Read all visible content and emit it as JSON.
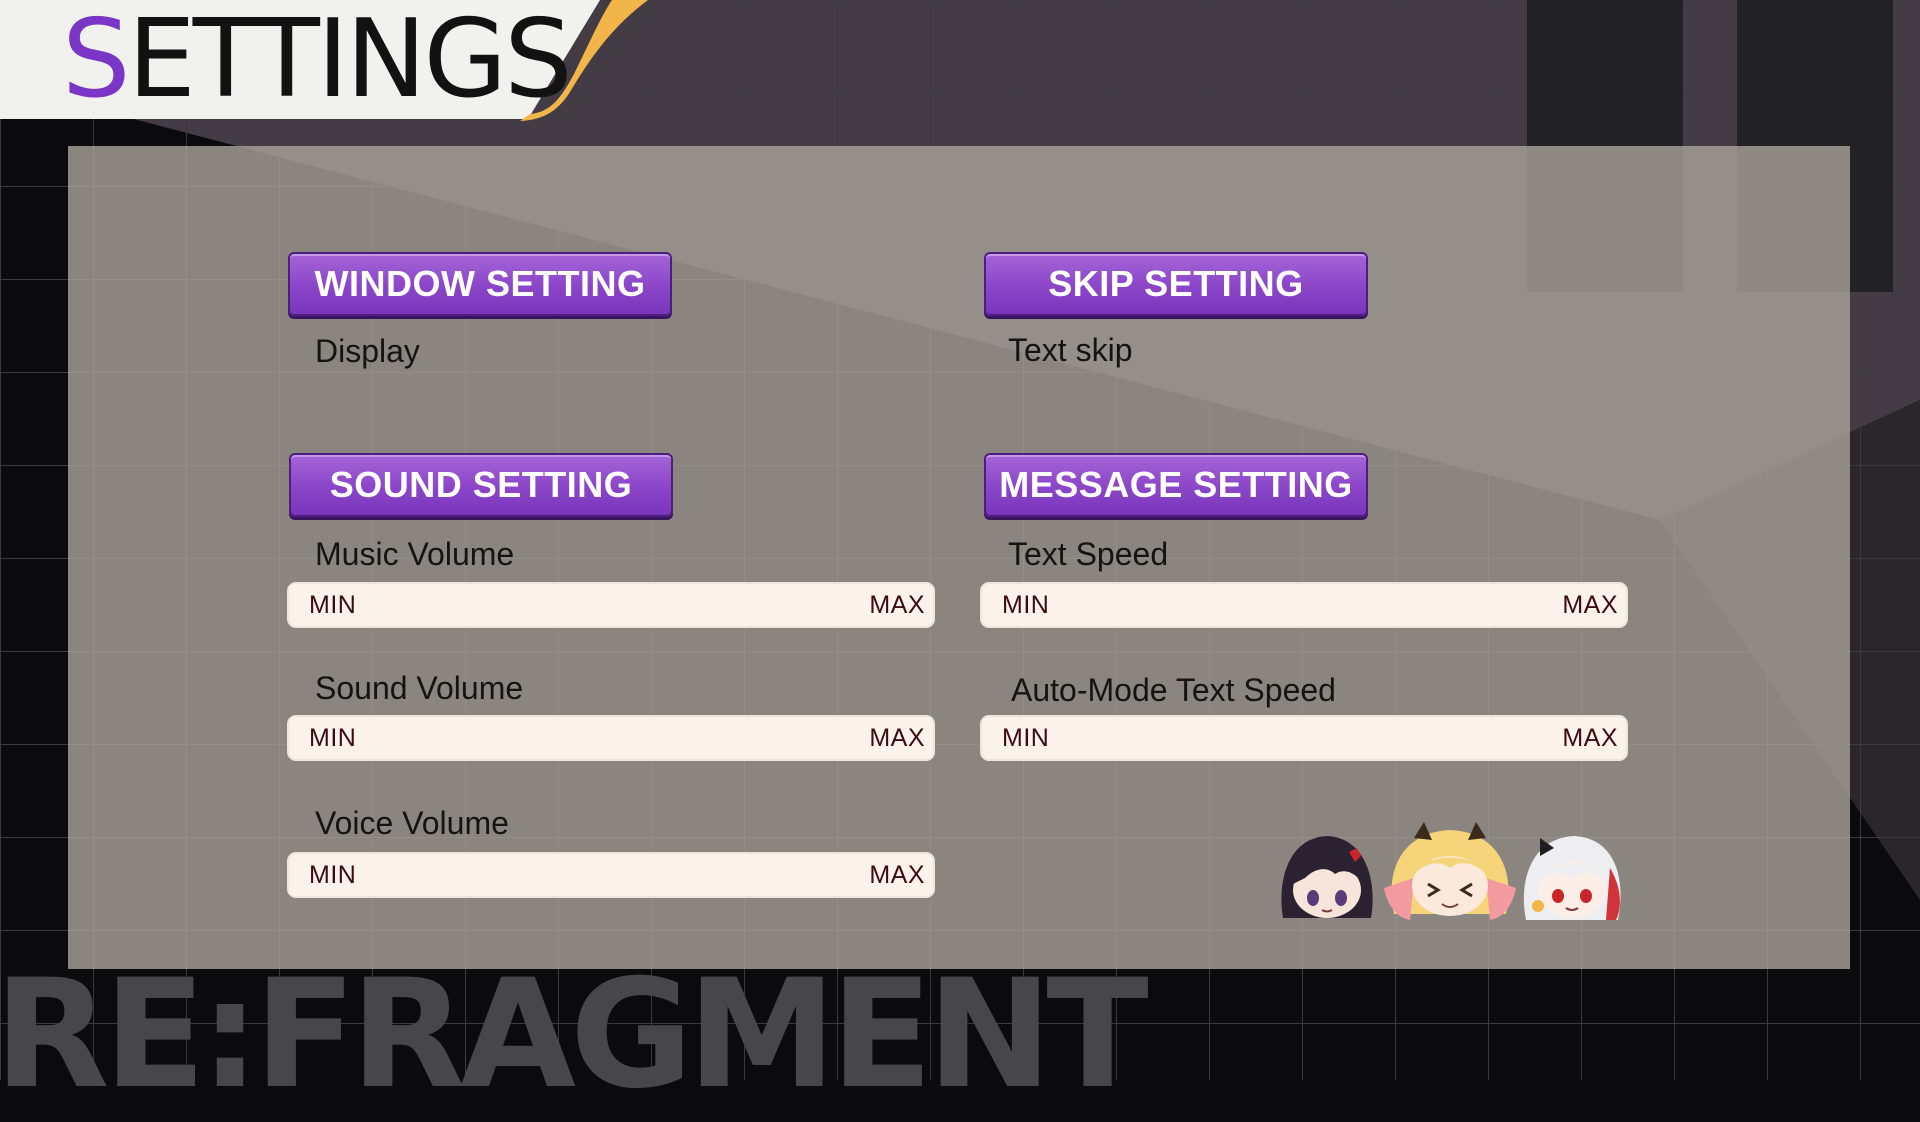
{
  "header": {
    "title_first": "S",
    "title_rest": "ETTINGS"
  },
  "sections": {
    "window": {
      "label": "WINDOW SETTING",
      "items": [
        "Display"
      ]
    },
    "skip": {
      "label": "SKIP SETTING",
      "items": [
        "Text skip"
      ]
    },
    "sound": {
      "label": "SOUND SETTING",
      "sliders": [
        {
          "label": "Music Volume",
          "min": "MIN",
          "max": "MAX"
        },
        {
          "label": "Sound Volume",
          "min": "MIN",
          "max": "MAX"
        },
        {
          "label": "Voice Volume",
          "min": "MIN",
          "max": "MAX"
        }
      ]
    },
    "message": {
      "label": "MESSAGE SETTING",
      "sliders": [
        {
          "label": "Text Speed",
          "min": "MIN",
          "max": "MAX"
        },
        {
          "label": "Auto-Mode Text Speed",
          "min": "MIN",
          "max": "MAX"
        }
      ]
    }
  },
  "watermark": "RE:FRAGMENT",
  "colors": {
    "accent_purple": "#8a45c8",
    "title_accent": "#7a36c6",
    "banner_orange": "#f2b54a",
    "slider_track": "#fbf3e9",
    "slider_text": "#3b0a18"
  },
  "icons": [
    "chibi-dark-hair-icon",
    "chibi-blonde-icon",
    "chibi-white-hair-icon"
  ]
}
